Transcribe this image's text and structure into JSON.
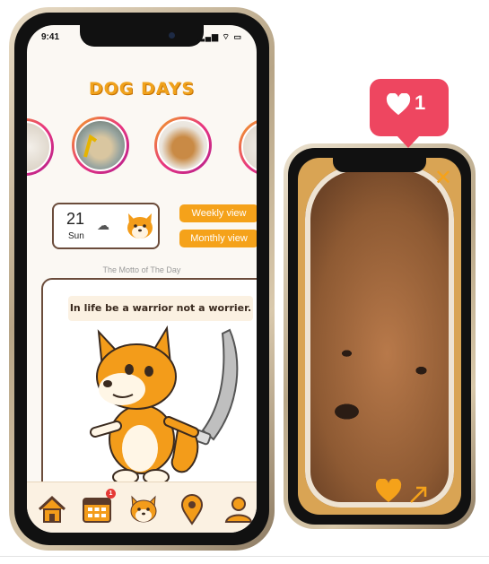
{
  "status": {
    "time": "9:41",
    "icons": "▂▄▆ ⌔ ▭"
  },
  "app": {
    "title": "DOG DAYS"
  },
  "date_card": {
    "day_number": "21",
    "weekday": "Sun",
    "weather_icon": "cloud-icon"
  },
  "buttons": {
    "weekly": "Weekly view",
    "monthly": "Monthly view"
  },
  "motto": {
    "label": "The Motto of The Day",
    "text": "In life be a warrior not a worrier."
  },
  "nav": {
    "calendar_badge": "1"
  },
  "second_phone": {
    "like_count": "1",
    "close_symbol": "✕"
  },
  "colors": {
    "accent": "#f5a21a",
    "brown": "#6b4c3b",
    "like": "#ee4660"
  }
}
